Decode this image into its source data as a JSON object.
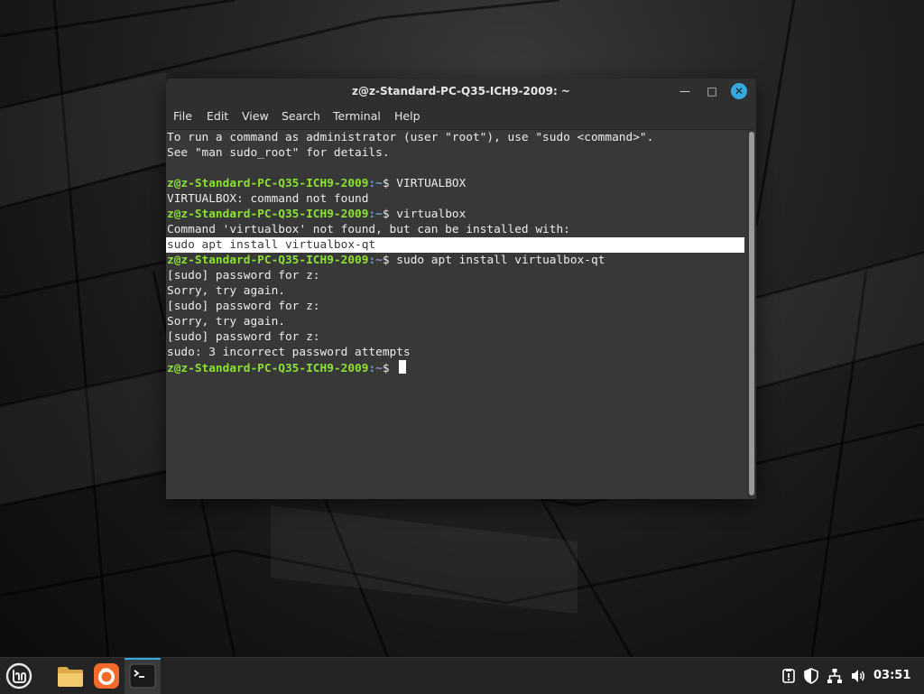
{
  "window": {
    "title": "z@z-Standard-PC-Q35-ICH9-2009: ~",
    "controls": {
      "minimize": "—",
      "maximize": "□",
      "close": "✕"
    }
  },
  "menu": [
    "File",
    "Edit",
    "View",
    "Search",
    "Terminal",
    "Help"
  ],
  "terminal": {
    "prompt_user": "z@z-Standard-PC-Q35-ICH9-2009",
    "prompt_path": ":~",
    "prompt_symbol": "$ ",
    "intro_1": "To run a command as administrator (user \"root\"), use \"sudo <command>\".",
    "intro_2": "See \"man sudo_root\" for details.",
    "cmd_1": "VIRTUALBOX",
    "out_1": "VIRTUALBOX: command not found",
    "cmd_2": "virtualbox",
    "out_2": "Command 'virtualbox' not found, but can be installed with:",
    "out_3": "sudo apt install virtualbox-qt",
    "cmd_3": "sudo apt install virtualbox-qt",
    "out_4": "[sudo] password for z:",
    "out_5": "Sorry, try again.",
    "out_6": "[sudo] password for z:",
    "out_7": "Sorry, try again.",
    "out_8": "[sudo] password for z:",
    "out_9": "sudo: 3 incorrect password attempts"
  },
  "taskbar": {
    "clock": "03:51",
    "apps": [
      "mint-menu-icon",
      "files-icon",
      "firefox-icon",
      "terminal-icon"
    ],
    "tray": [
      "update-manager-icon",
      "shield-icon",
      "network-icon",
      "volume-icon"
    ]
  },
  "colors": {
    "accent": "#35a8e0",
    "prompt_green": "#8ae234",
    "prompt_blue": "#729fcf",
    "terminal_bg": "#383838"
  }
}
